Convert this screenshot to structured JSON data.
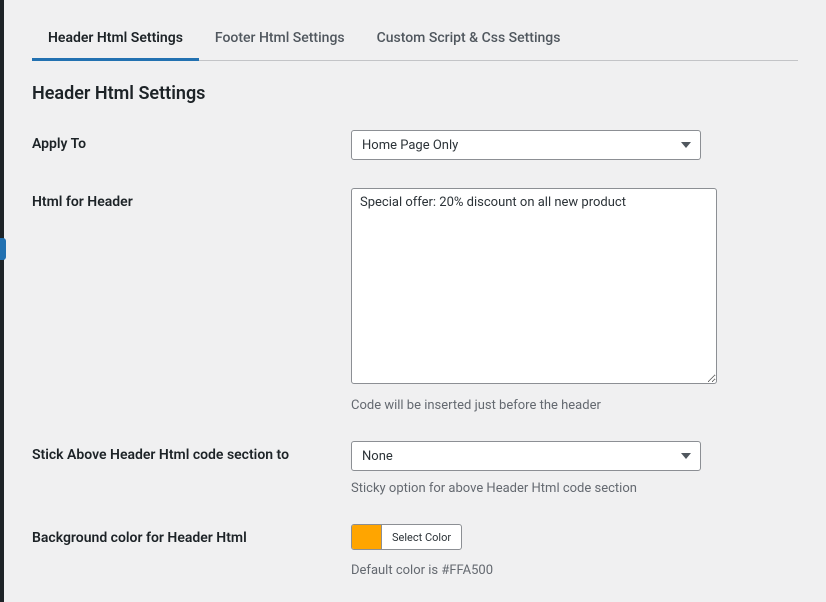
{
  "tabs": [
    {
      "label": "Header Html Settings",
      "active": true
    },
    {
      "label": "Footer Html Settings",
      "active": false
    },
    {
      "label": "Custom Script & Css Settings",
      "active": false
    }
  ],
  "section_title": "Header Html Settings",
  "fields": {
    "apply_to": {
      "label": "Apply To",
      "value": "Home Page Only"
    },
    "html_header": {
      "label": "Html for Header",
      "value": "Special offer: 20% discount on all new product",
      "description": "Code will be inserted just before the header"
    },
    "stick_to": {
      "label": "Stick Above Header Html code section to",
      "value": "None",
      "description": "Sticky option for above Header Html code section"
    },
    "bg_color": {
      "label": "Background color for Header Html",
      "button": "Select Color",
      "swatch": "#FFA500",
      "description": "Default color is #FFA500"
    }
  }
}
